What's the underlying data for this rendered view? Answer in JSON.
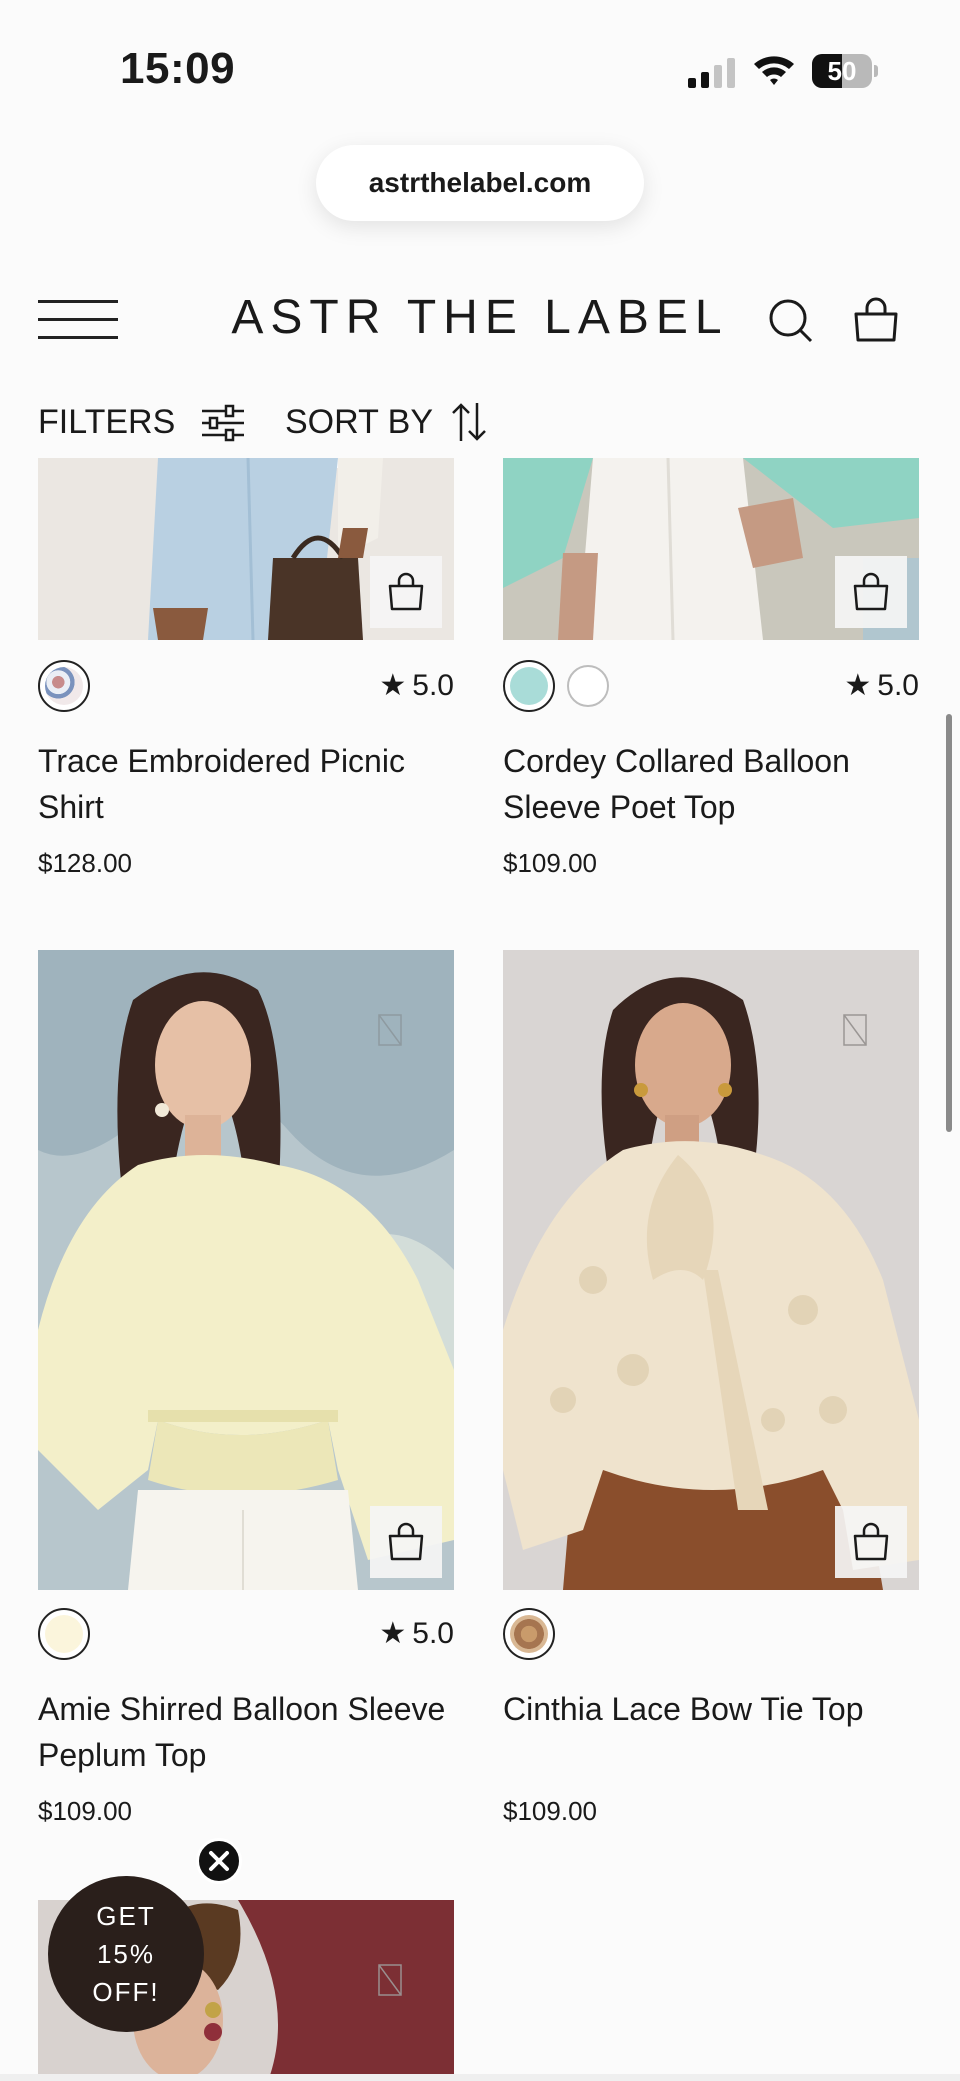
{
  "status_bar": {
    "time": "15:09",
    "battery": "50",
    "battery_level_percent": 50
  },
  "browser": {
    "url": "astrthelabel.com"
  },
  "header": {
    "logo": "ASTR THE LABEL"
  },
  "toolbar": {
    "filters_label": "FILTERS",
    "sort_label": "SORT BY"
  },
  "products": [
    {
      "name": "Trace Embroidered Picnic Shirt",
      "price": "$128.00",
      "rating": "5.0",
      "swatches": [
        "floral-print"
      ]
    },
    {
      "name": "Cordey Collared Balloon Sleeve Poet Top",
      "price": "$109.00",
      "rating": "5.0",
      "swatches": [
        "#a9dcd8",
        "#ffffff"
      ]
    },
    {
      "name": "Amie Shirred Balloon Sleeve Peplum Top",
      "price": "$109.00",
      "rating": "5.0",
      "swatches": [
        "#fbf5dc"
      ]
    },
    {
      "name": "Cinthia Lace Bow Tie Top",
      "price": "$109.00",
      "rating": "",
      "swatches": [
        "lace-print"
      ]
    }
  ],
  "promo": {
    "line1": "GET",
    "line2": "15%",
    "line3": "OFF!"
  },
  "colors": {
    "text": "#1a1a1a",
    "promo_bg": "#2a1f1b",
    "mint": "#a9dcd8",
    "cream": "#fbf5dc"
  }
}
